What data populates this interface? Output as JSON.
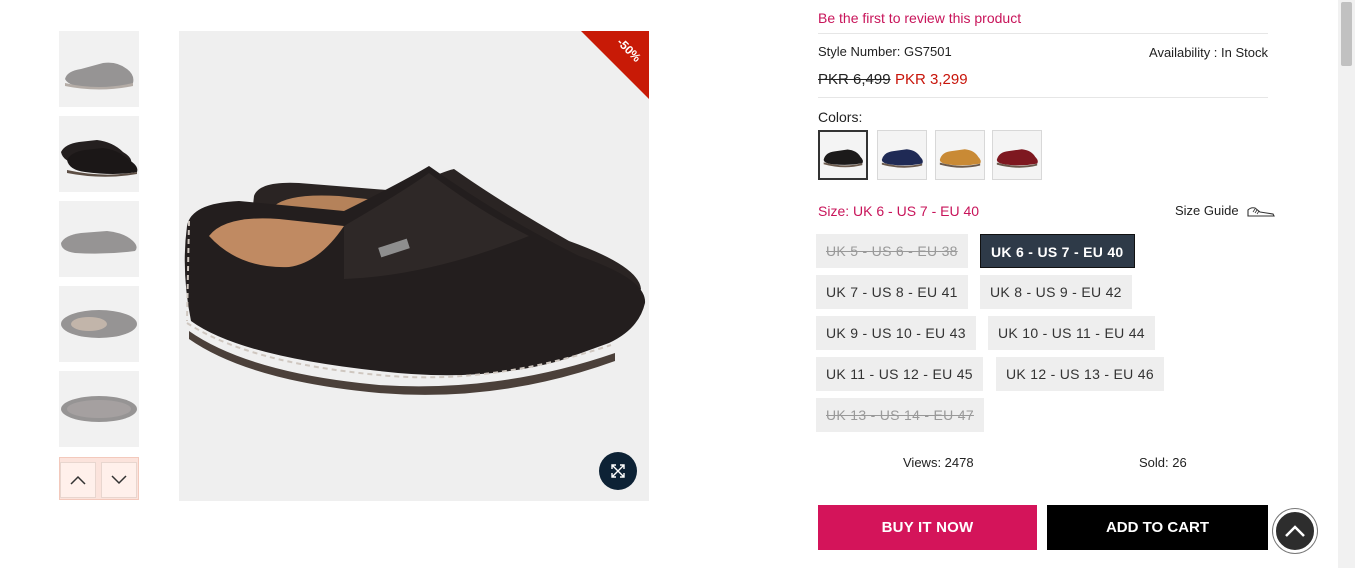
{
  "thumbnails": [
    {
      "name": "thumb-1",
      "state": "dim"
    },
    {
      "name": "thumb-2",
      "state": "active"
    },
    {
      "name": "thumb-3",
      "state": "dim"
    },
    {
      "name": "thumb-4",
      "state": "dim"
    },
    {
      "name": "thumb-5",
      "state": "dim"
    }
  ],
  "gallery": {
    "sale_badge": "-50%",
    "prev_icon": "chevron-up-icon",
    "next_icon": "chevron-down-icon",
    "zoom_icon": "expand-icon"
  },
  "product": {
    "review_link": "Be the first to review this product",
    "style_number": "Style Number: GS7501",
    "availability": "Availability : In Stock",
    "price_old": "PKR 6,499",
    "price_new": "PKR 3,299"
  },
  "colors": {
    "label": "Colors:",
    "options": [
      {
        "name": "black",
        "hex": "#1c1a1a",
        "selected": true
      },
      {
        "name": "navy",
        "hex": "#1f2a55",
        "selected": false
      },
      {
        "name": "tan",
        "hex": "#c98a35",
        "selected": false
      },
      {
        "name": "maroon",
        "hex": "#7e1820",
        "selected": false
      }
    ]
  },
  "size": {
    "label": "Size: UK 6 - US 7 - EU 40",
    "guide_label": "Size Guide",
    "options": [
      {
        "label": "UK 5 - US 6 - EU 38",
        "state": "oos"
      },
      {
        "label": "UK 6 - US 7 - EU 40",
        "state": "selected"
      },
      {
        "label": "UK 7 - US 8 - EU 41",
        "state": "available"
      },
      {
        "label": "UK 8 - US 9 - EU 42",
        "state": "available"
      },
      {
        "label": "UK 9 - US 10 - EU 43",
        "state": "available"
      },
      {
        "label": "UK 10 - US 11 - EU 44",
        "state": "available"
      },
      {
        "label": "UK 11 - US 12 - EU 45",
        "state": "available"
      },
      {
        "label": "UK 12 - US 13 - EU 46",
        "state": "available"
      },
      {
        "label": "UK 13 - US 14 - EU 47",
        "state": "oos"
      }
    ]
  },
  "stats": {
    "views": "Views: 2478",
    "sold": "Sold: 26"
  },
  "actions": {
    "buy_now": "BUY IT NOW",
    "add_to_cart": "ADD TO CART"
  },
  "colors_theme": {
    "accent": "#d4145a",
    "sale_red": "#c8140a",
    "selected_size_bg": "#2e3a48"
  }
}
